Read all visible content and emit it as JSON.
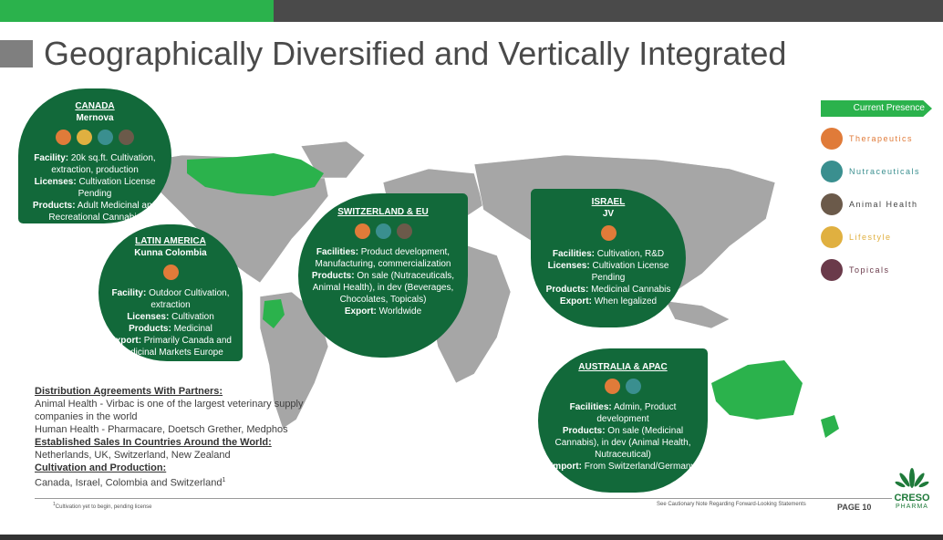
{
  "header": {
    "title": "Geographically Diversified and Vertically Integrated"
  },
  "canada": {
    "title": "CANADA",
    "subtitle": "Mernova",
    "facility_label": "Facility:",
    "facility": " 20k sq.ft. Cultivation, extraction, production",
    "licenses_label": "Licenses:",
    "licenses": " Cultivation License Pending",
    "products_label": "Products:",
    "products": " Adult Medicinal and Recreational Cannabis"
  },
  "latam": {
    "title": "LATIN AMERICA",
    "subtitle": "Kunna Colombia",
    "facility_label": "Facility:",
    "facility": " Outdoor Cultivation, extraction",
    "licenses_label": "Licenses:",
    "licenses": " Cultivation",
    "products_label": "Products:",
    "products": " Medicinal",
    "export_label": "Export:",
    "export": " Primarily Canada and Medicinal Markets Europe"
  },
  "swiss": {
    "title": "SWITZERLAND & EU",
    "facilities_label": "Facilities:",
    "facilities": " Product development, Manufacturing, commercialization",
    "products_label": "Products:",
    "products": " On sale (Nutraceuticals, Animal Health), in dev (Beverages, Chocolates, Topicals)",
    "export_label": "Export:",
    "export": " Worldwide"
  },
  "israel": {
    "title": "ISRAEL",
    "subtitle": "JV",
    "facilities_label": "Facilities:",
    "facilities": " Cultivation, R&D",
    "licenses_label": "Licenses:",
    "licenses": " Cultivation License Pending",
    "products_label": "Products:",
    "products": " Medicinal Cannabis",
    "export_label": "Export:",
    "export": " When legalized"
  },
  "australia": {
    "title": "AUSTRALIA & APAC",
    "facilities_label": "Facilities:",
    "facilities": " Admin, Product development",
    "products_label": "Products:",
    "products": " On sale (Medicinal Cannabis), in dev (Animal Health, Nutraceutical)",
    "import_label": "Import:",
    "import": " From Switzerland/Germany"
  },
  "legend": {
    "header": "Current Presence",
    "items": [
      {
        "label": "Therapeutics",
        "color": "#e07b39",
        "icon": "therapeutics-icon"
      },
      {
        "label": "Nutraceuticals",
        "color": "#3a8f8f",
        "icon": "nutraceuticals-icon"
      },
      {
        "label": "Animal Health",
        "color": "#6b5a4a",
        "icon": "animal-health-icon"
      },
      {
        "label": "Lifestyle",
        "color": "#e0b040",
        "icon": "lifestyle-icon"
      },
      {
        "label": "Topicals",
        "color": "#6a3a4a",
        "icon": "topicals-icon"
      }
    ]
  },
  "distribution": {
    "heading1": "Distribution Agreements With Partners:",
    "line1": "Animal Health - Virbac is one of the largest veterinary supply companies in the world",
    "line2": "Human Health - Pharmacare, Doetsch Grether, Medphos",
    "heading2": "Established Sales In Countries Around the World:",
    "line3": "Netherlands, UK, Switzerland, New Zealand",
    "heading3": "Cultivation and Production:",
    "line4": "Canada, Israel, Colombia and Switzerland",
    "sup": "1"
  },
  "footer": {
    "footnote_sup": "1",
    "footnote": "Cultivation yet to begin, pending license",
    "caution": "See Cautionary Note Regarding Forward-Looking Statements",
    "page": "PAGE 10"
  },
  "logo": {
    "name": "CRESO",
    "sub": "PHARMA"
  },
  "colors": {
    "brand_green": "#2bb24c",
    "bubble_green": "#12693a",
    "map_grey": "#a6a6a6",
    "map_highlight": "#2bb24c"
  }
}
